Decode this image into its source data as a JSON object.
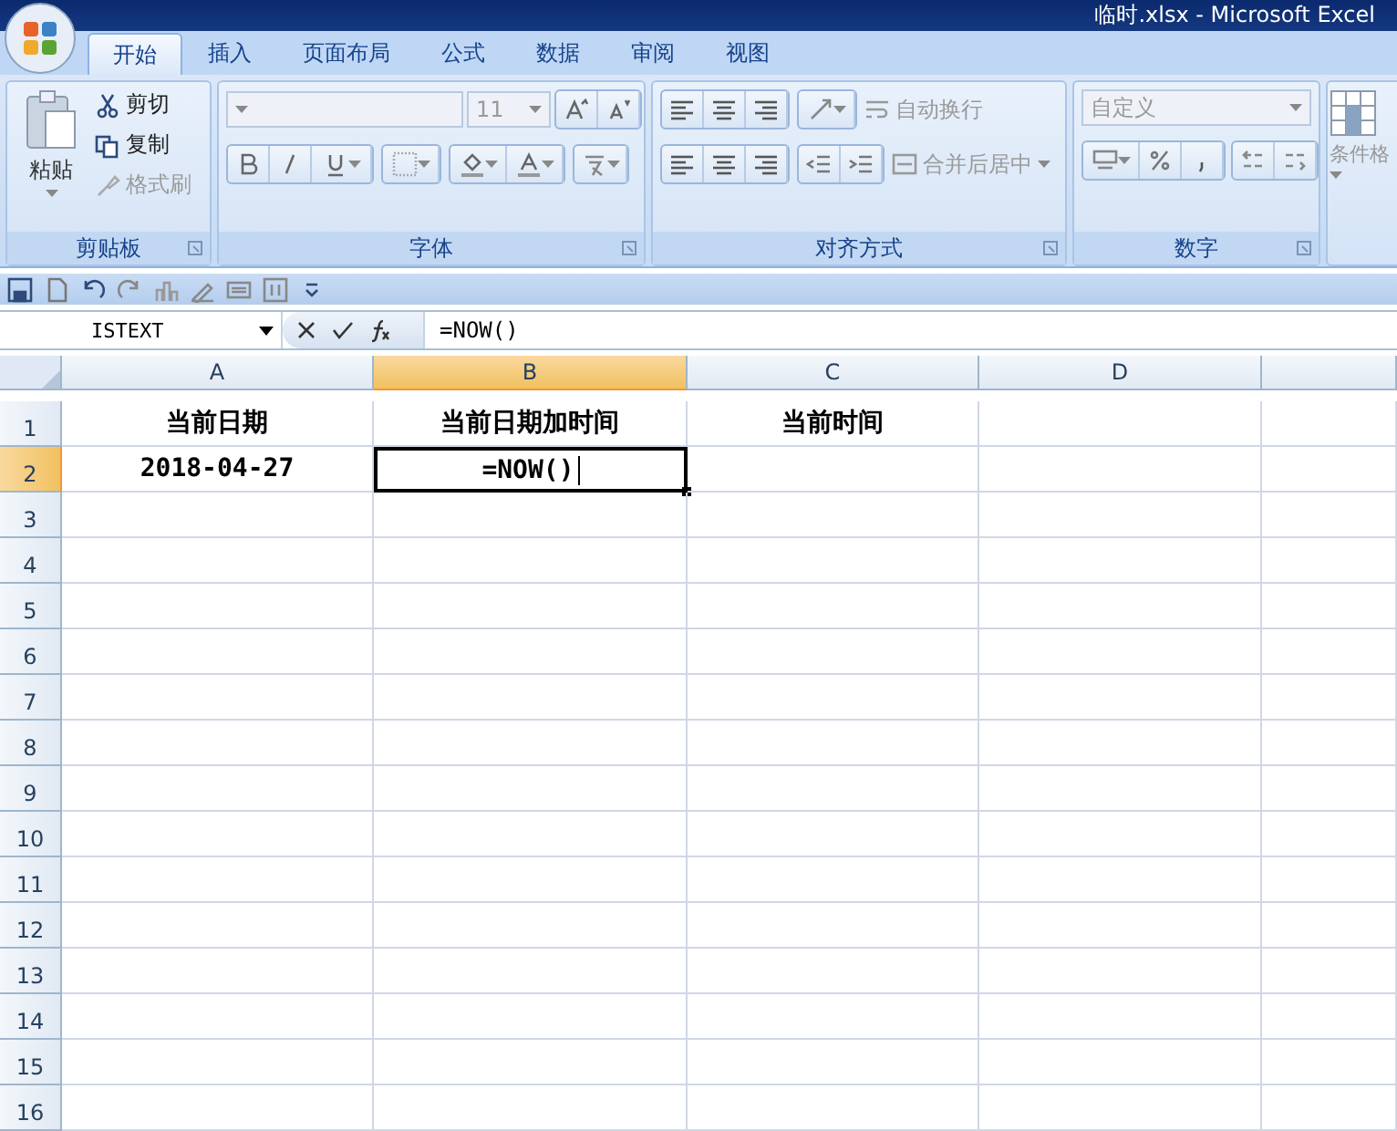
{
  "window": {
    "title": "临时.xlsx - Microsoft Excel"
  },
  "tabs": [
    {
      "label": "开始",
      "selected": true
    },
    {
      "label": "插入",
      "selected": false
    },
    {
      "label": "页面布局",
      "selected": false
    },
    {
      "label": "公式",
      "selected": false
    },
    {
      "label": "数据",
      "selected": false
    },
    {
      "label": "审阅",
      "selected": false
    },
    {
      "label": "视图",
      "selected": false
    }
  ],
  "ribbon": {
    "clipboard": {
      "label": "剪贴板",
      "paste": "粘贴",
      "items": [
        {
          "label": "剪切",
          "disabled": false
        },
        {
          "label": "复制",
          "disabled": false
        },
        {
          "label": "格式刷",
          "disabled": true
        }
      ]
    },
    "font": {
      "label": "字体",
      "size": "11"
    },
    "alignment": {
      "label": "对齐方式",
      "wrap": "自动换行",
      "merge": "合并后居中"
    },
    "number": {
      "label": "数字",
      "format": "自定义"
    },
    "styles": {
      "conditional": "条件格"
    }
  },
  "formula_bar": {
    "name_box": "ISTEXT",
    "formula": "=NOW()"
  },
  "sheet": {
    "columns": [
      {
        "label": "A",
        "selected": false
      },
      {
        "label": "B",
        "selected": true
      },
      {
        "label": "C",
        "selected": false
      },
      {
        "label": "D",
        "selected": false
      }
    ],
    "rows": [
      {
        "number": "1",
        "selected": false,
        "cells": [
          {
            "text": "当前日期",
            "active": false
          },
          {
            "text": "当前日期加时间",
            "active": false
          },
          {
            "text": "当前时间",
            "active": false
          }
        ]
      },
      {
        "number": "2",
        "selected": true,
        "cells": [
          {
            "text": "2018-04-27",
            "active": false
          },
          {
            "text": "=NOW()",
            "active": true
          }
        ]
      },
      {
        "number": "3",
        "selected": false
      },
      {
        "number": "4",
        "selected": false
      },
      {
        "number": "5",
        "selected": false
      },
      {
        "number": "6",
        "selected": false
      },
      {
        "number": "7",
        "selected": false
      },
      {
        "number": "8",
        "selected": false
      },
      {
        "number": "9",
        "selected": false
      },
      {
        "number": "10",
        "selected": false
      },
      {
        "number": "11",
        "selected": false
      },
      {
        "number": "12",
        "selected": false
      },
      {
        "number": "13",
        "selected": false
      },
      {
        "number": "14",
        "selected": false
      },
      {
        "number": "15",
        "selected": false
      },
      {
        "number": "16",
        "selected": false
      }
    ]
  }
}
